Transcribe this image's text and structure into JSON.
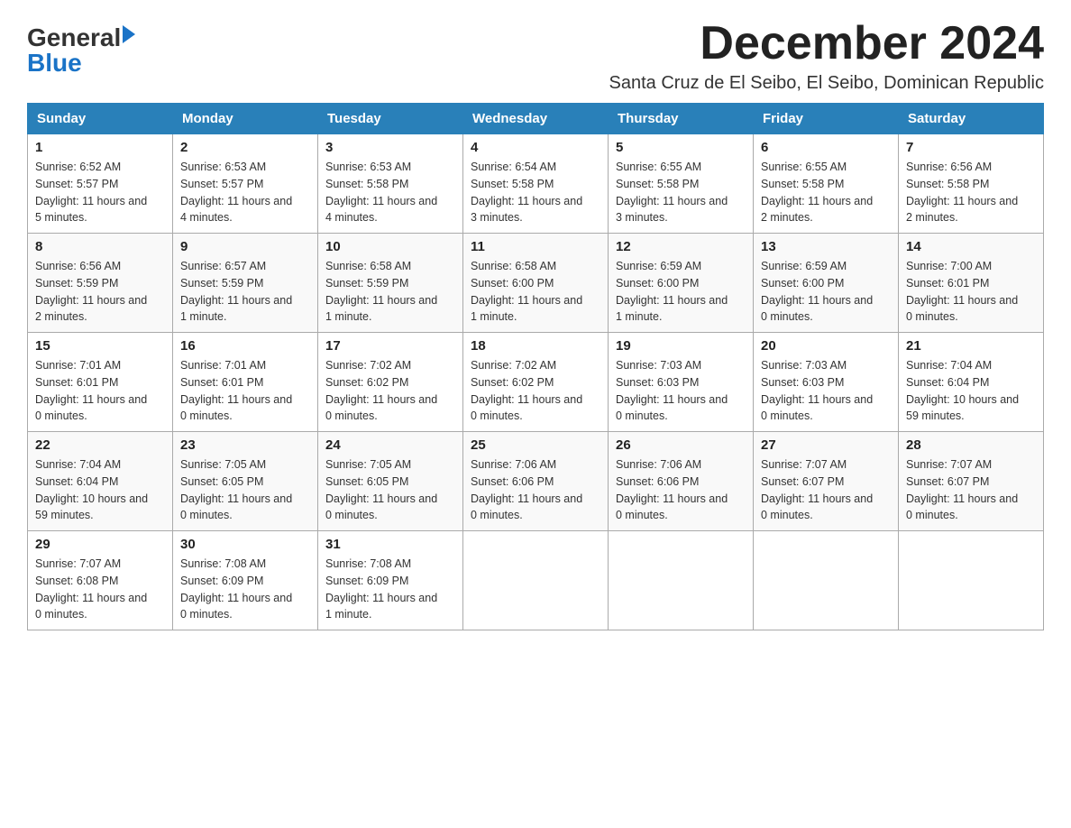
{
  "header": {
    "logo_general": "General",
    "logo_blue": "Blue",
    "main_title": "December 2024",
    "subtitle": "Santa Cruz de El Seibo, El Seibo, Dominican Republic"
  },
  "weekdays": [
    "Sunday",
    "Monday",
    "Tuesday",
    "Wednesday",
    "Thursday",
    "Friday",
    "Saturday"
  ],
  "weeks": [
    [
      {
        "day": "1",
        "sunrise": "6:52 AM",
        "sunset": "5:57 PM",
        "daylight": "11 hours and 5 minutes."
      },
      {
        "day": "2",
        "sunrise": "6:53 AM",
        "sunset": "5:57 PM",
        "daylight": "11 hours and 4 minutes."
      },
      {
        "day": "3",
        "sunrise": "6:53 AM",
        "sunset": "5:58 PM",
        "daylight": "11 hours and 4 minutes."
      },
      {
        "day": "4",
        "sunrise": "6:54 AM",
        "sunset": "5:58 PM",
        "daylight": "11 hours and 3 minutes."
      },
      {
        "day": "5",
        "sunrise": "6:55 AM",
        "sunset": "5:58 PM",
        "daylight": "11 hours and 3 minutes."
      },
      {
        "day": "6",
        "sunrise": "6:55 AM",
        "sunset": "5:58 PM",
        "daylight": "11 hours and 2 minutes."
      },
      {
        "day": "7",
        "sunrise": "6:56 AM",
        "sunset": "5:58 PM",
        "daylight": "11 hours and 2 minutes."
      }
    ],
    [
      {
        "day": "8",
        "sunrise": "6:56 AM",
        "sunset": "5:59 PM",
        "daylight": "11 hours and 2 minutes."
      },
      {
        "day": "9",
        "sunrise": "6:57 AM",
        "sunset": "5:59 PM",
        "daylight": "11 hours and 1 minute."
      },
      {
        "day": "10",
        "sunrise": "6:58 AM",
        "sunset": "5:59 PM",
        "daylight": "11 hours and 1 minute."
      },
      {
        "day": "11",
        "sunrise": "6:58 AM",
        "sunset": "6:00 PM",
        "daylight": "11 hours and 1 minute."
      },
      {
        "day": "12",
        "sunrise": "6:59 AM",
        "sunset": "6:00 PM",
        "daylight": "11 hours and 1 minute."
      },
      {
        "day": "13",
        "sunrise": "6:59 AM",
        "sunset": "6:00 PM",
        "daylight": "11 hours and 0 minutes."
      },
      {
        "day": "14",
        "sunrise": "7:00 AM",
        "sunset": "6:01 PM",
        "daylight": "11 hours and 0 minutes."
      }
    ],
    [
      {
        "day": "15",
        "sunrise": "7:01 AM",
        "sunset": "6:01 PM",
        "daylight": "11 hours and 0 minutes."
      },
      {
        "day": "16",
        "sunrise": "7:01 AM",
        "sunset": "6:01 PM",
        "daylight": "11 hours and 0 minutes."
      },
      {
        "day": "17",
        "sunrise": "7:02 AM",
        "sunset": "6:02 PM",
        "daylight": "11 hours and 0 minutes."
      },
      {
        "day": "18",
        "sunrise": "7:02 AM",
        "sunset": "6:02 PM",
        "daylight": "11 hours and 0 minutes."
      },
      {
        "day": "19",
        "sunrise": "7:03 AM",
        "sunset": "6:03 PM",
        "daylight": "11 hours and 0 minutes."
      },
      {
        "day": "20",
        "sunrise": "7:03 AM",
        "sunset": "6:03 PM",
        "daylight": "11 hours and 0 minutes."
      },
      {
        "day": "21",
        "sunrise": "7:04 AM",
        "sunset": "6:04 PM",
        "daylight": "10 hours and 59 minutes."
      }
    ],
    [
      {
        "day": "22",
        "sunrise": "7:04 AM",
        "sunset": "6:04 PM",
        "daylight": "10 hours and 59 minutes."
      },
      {
        "day": "23",
        "sunrise": "7:05 AM",
        "sunset": "6:05 PM",
        "daylight": "11 hours and 0 minutes."
      },
      {
        "day": "24",
        "sunrise": "7:05 AM",
        "sunset": "6:05 PM",
        "daylight": "11 hours and 0 minutes."
      },
      {
        "day": "25",
        "sunrise": "7:06 AM",
        "sunset": "6:06 PM",
        "daylight": "11 hours and 0 minutes."
      },
      {
        "day": "26",
        "sunrise": "7:06 AM",
        "sunset": "6:06 PM",
        "daylight": "11 hours and 0 minutes."
      },
      {
        "day": "27",
        "sunrise": "7:07 AM",
        "sunset": "6:07 PM",
        "daylight": "11 hours and 0 minutes."
      },
      {
        "day": "28",
        "sunrise": "7:07 AM",
        "sunset": "6:07 PM",
        "daylight": "11 hours and 0 minutes."
      }
    ],
    [
      {
        "day": "29",
        "sunrise": "7:07 AM",
        "sunset": "6:08 PM",
        "daylight": "11 hours and 0 minutes."
      },
      {
        "day": "30",
        "sunrise": "7:08 AM",
        "sunset": "6:09 PM",
        "daylight": "11 hours and 0 minutes."
      },
      {
        "day": "31",
        "sunrise": "7:08 AM",
        "sunset": "6:09 PM",
        "daylight": "11 hours and 1 minute."
      },
      null,
      null,
      null,
      null
    ]
  ],
  "labels": {
    "sunrise": "Sunrise:",
    "sunset": "Sunset:",
    "daylight": "Daylight:"
  }
}
